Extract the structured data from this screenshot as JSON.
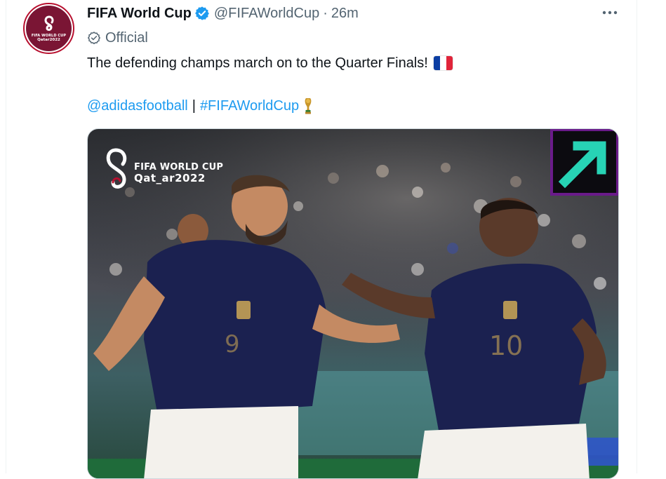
{
  "tweet": {
    "display_name": "FIFA World Cup",
    "handle": "@FIFAWorldCup",
    "separator": "·",
    "timestamp": "26m",
    "official_label": "Official",
    "text": "The defending champs march on to the Quarter Finals!",
    "flag_icon": "france-flag-icon",
    "link_1": "@adidasfootball",
    "link_separator": "|",
    "link_2": "#FIFAWorldCup",
    "trophy_icon": "trophy-icon"
  },
  "avatar": {
    "logo_line_1": "FIFA WORLD CUP",
    "logo_line_2": "Qatar2022"
  },
  "media": {
    "overlay_line_1": "FIFA WORLD CUP",
    "overlay_line_2": "Qat_ar2022",
    "brand_arrow_icon": "arrow-up-right-icon",
    "jersey_number_left": "9",
    "jersey_number_right": "10"
  },
  "colors": {
    "accent": "#1d9bf0",
    "secondary_text": "#536471",
    "avatar_bg": "#7a1534",
    "arrow_teal": "#27d3b5",
    "arrow_border": "#6a1b8a",
    "jersey": "#1b2150"
  }
}
